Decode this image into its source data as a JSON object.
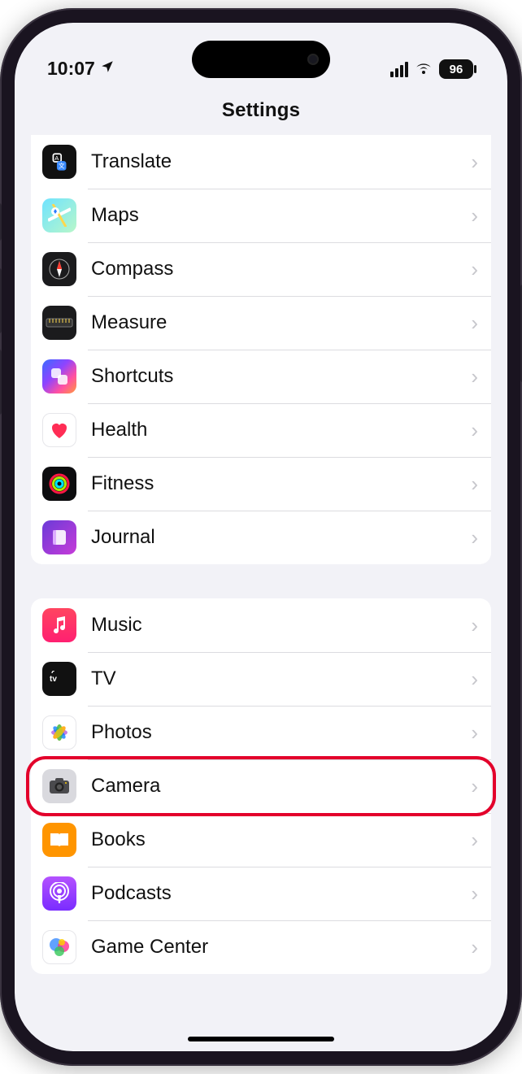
{
  "status": {
    "time": "10:07",
    "battery": "96"
  },
  "nav": {
    "title": "Settings"
  },
  "highlighted_item": "camera",
  "groups": [
    {
      "items": [
        {
          "id": "translate",
          "label": "Translate"
        },
        {
          "id": "maps",
          "label": "Maps"
        },
        {
          "id": "compass",
          "label": "Compass"
        },
        {
          "id": "measure",
          "label": "Measure"
        },
        {
          "id": "shortcuts",
          "label": "Shortcuts"
        },
        {
          "id": "health",
          "label": "Health"
        },
        {
          "id": "fitness",
          "label": "Fitness"
        },
        {
          "id": "journal",
          "label": "Journal"
        }
      ]
    },
    {
      "items": [
        {
          "id": "music",
          "label": "Music"
        },
        {
          "id": "tv",
          "label": "TV"
        },
        {
          "id": "photos",
          "label": "Photos"
        },
        {
          "id": "camera",
          "label": "Camera"
        },
        {
          "id": "books",
          "label": "Books"
        },
        {
          "id": "podcasts",
          "label": "Podcasts"
        },
        {
          "id": "gc",
          "label": "Game Center"
        }
      ]
    }
  ]
}
